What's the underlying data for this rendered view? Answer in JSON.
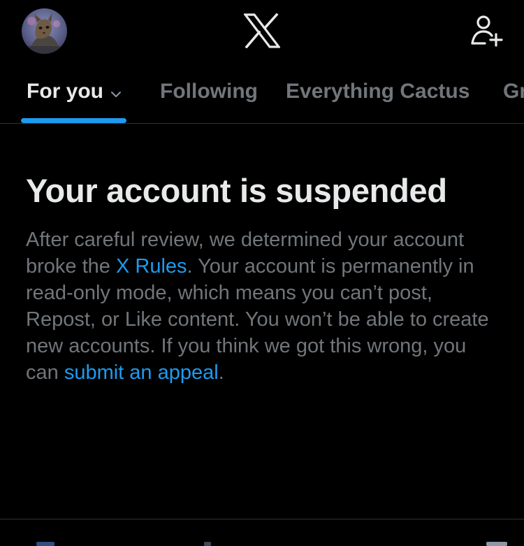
{
  "topbar": {
    "avatar_icon": "user-avatar-photo",
    "logo_icon": "x-logo-icon",
    "follow_icon": "add-user-icon"
  },
  "tabs": [
    {
      "label": "For you",
      "active": true,
      "has_dropdown": true
    },
    {
      "label": "Following",
      "active": false
    },
    {
      "label": "Everything Cactus",
      "active": false
    },
    {
      "label": "Gr",
      "active": false
    }
  ],
  "notice": {
    "title": "Your account is suspended",
    "body_part1": "After careful review, we determined your account broke the ",
    "rules_link": "X Rules",
    "body_part2": ". Your account is permanently in read-only mode, which means you can’t post, Repost, or Like content. You won’t be able to create new accounts. If you think we got this wrong, you can ",
    "appeal_link": "submit an appeal",
    "body_end": "."
  },
  "colors": {
    "background": "#000000",
    "text_primary": "#e7e9ea",
    "text_secondary": "#71767b",
    "accent": "#1d9bf0",
    "divider": "#2f3336"
  }
}
